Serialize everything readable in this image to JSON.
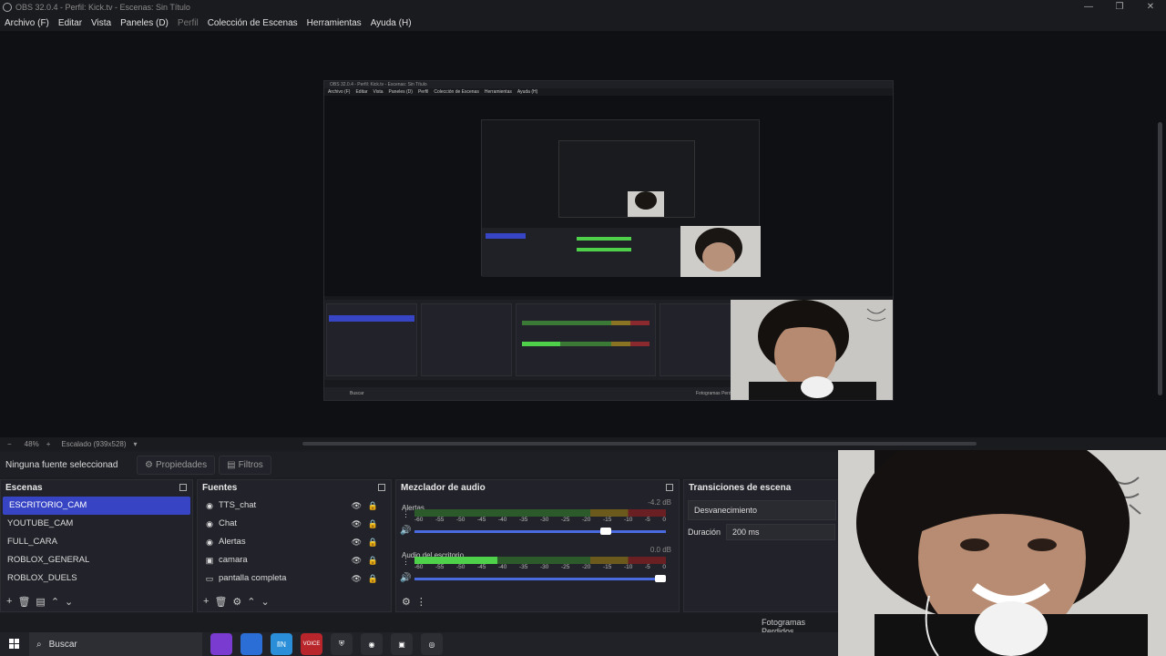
{
  "window": {
    "title": "OBS 32.0.4 - Perfil: Kick.tv - Escenas: Sin Título",
    "controls": [
      "—",
      "❐",
      "✕"
    ]
  },
  "menu": [
    {
      "label": "Archivo (F)",
      "dim": false
    },
    {
      "label": "Editar",
      "dim": false
    },
    {
      "label": "Vista",
      "dim": false
    },
    {
      "label": "Paneles (D)",
      "dim": false
    },
    {
      "label": "Perfil",
      "dim": true
    },
    {
      "label": "Colección de Escenas",
      "dim": false
    },
    {
      "label": "Herramientas",
      "dim": false
    },
    {
      "label": "Ayuda (H)",
      "dim": false
    }
  ],
  "nested_preview": {
    "title": "OBS 32.0.4 - Perfil: Kick.tv - Escenas: Sin Título",
    "menu": [
      "Archivo (F)",
      "Editar",
      "Vista",
      "Paneles (D)",
      "Perfil",
      "Colección de Escenas",
      "Herramientas",
      "Ayuda (H)"
    ],
    "taskbar_search": "Buscar",
    "frames_label": "Fotogramas Perdidos"
  },
  "zoom": {
    "minus": "−",
    "percent": "48%",
    "plus": "+",
    "scaled": "Escalado (939x528)",
    "dropdown": "▾"
  },
  "props": {
    "no_source": "Ninguna fuente seleccionad",
    "properties_label": "Propiedades",
    "filters_label": "Filtros"
  },
  "scenes": {
    "title": "Escenas",
    "items": [
      "ESCRITORIO_CAM",
      "YOUTUBE_CAM",
      "FULL_CARA",
      "ROBLOX_GENERAL",
      "ROBLOX_DUELS"
    ],
    "active_index": 0
  },
  "sources": {
    "title": "Fuentes",
    "items": [
      {
        "label": "TTS_chat",
        "icon": "browser-icon"
      },
      {
        "label": "Chat",
        "icon": "browser-icon"
      },
      {
        "label": "Alertas",
        "icon": "browser-icon"
      },
      {
        "label": "camara",
        "icon": "camera-icon"
      },
      {
        "label": "pantalla completa",
        "icon": "monitor-icon"
      }
    ]
  },
  "mixer": {
    "title": "Mezclador de audio",
    "ticks": [
      "-60",
      "-55",
      "-50",
      "-45",
      "-40",
      "-35",
      "-30",
      "-25",
      "-20",
      "-15",
      "-10",
      "-5",
      "0"
    ],
    "channels": [
      {
        "name": "Alertas",
        "db": "-4.2 dB",
        "level": 0.0,
        "fader": 0.76
      },
      {
        "name": "Audio del escritorio",
        "db": "0.0 dB",
        "level": 0.33,
        "fader": 0.98
      }
    ]
  },
  "transitions": {
    "title": "Transiciones de escena",
    "type": "Desvanecimiento",
    "duration_label": "Duración",
    "duration_value": "200 ms"
  },
  "status": {
    "frames_label": "Fotogramas Perdidos"
  },
  "taskbar": {
    "search_placeholder": "Buscar",
    "apps": [
      {
        "name": "chrome-canary-icon",
        "color": "#7a3cd0",
        "text": ""
      },
      {
        "name": "chrome-icon",
        "color": "#2b6fd6",
        "text": ""
      },
      {
        "name": "wave-icon",
        "color": "#2a8fd8",
        "text": "ſIN"
      },
      {
        "name": "voice-meter-icon",
        "color": "#b8262b",
        "text": "VOICE"
      },
      {
        "name": "shield-icon",
        "color": "#2c2e34",
        "text": ""
      },
      {
        "name": "obs-icon",
        "color": "#2c2e34",
        "text": ""
      },
      {
        "name": "multi-window-icon",
        "color": "#2c2e34",
        "text": ""
      },
      {
        "name": "chrome-alt-icon",
        "color": "#2c2e34",
        "text": ""
      }
    ]
  },
  "colors": {
    "accent": "#3745c4",
    "meter_green": "#4ed04a",
    "fader_blue": "#4a6ae0"
  }
}
